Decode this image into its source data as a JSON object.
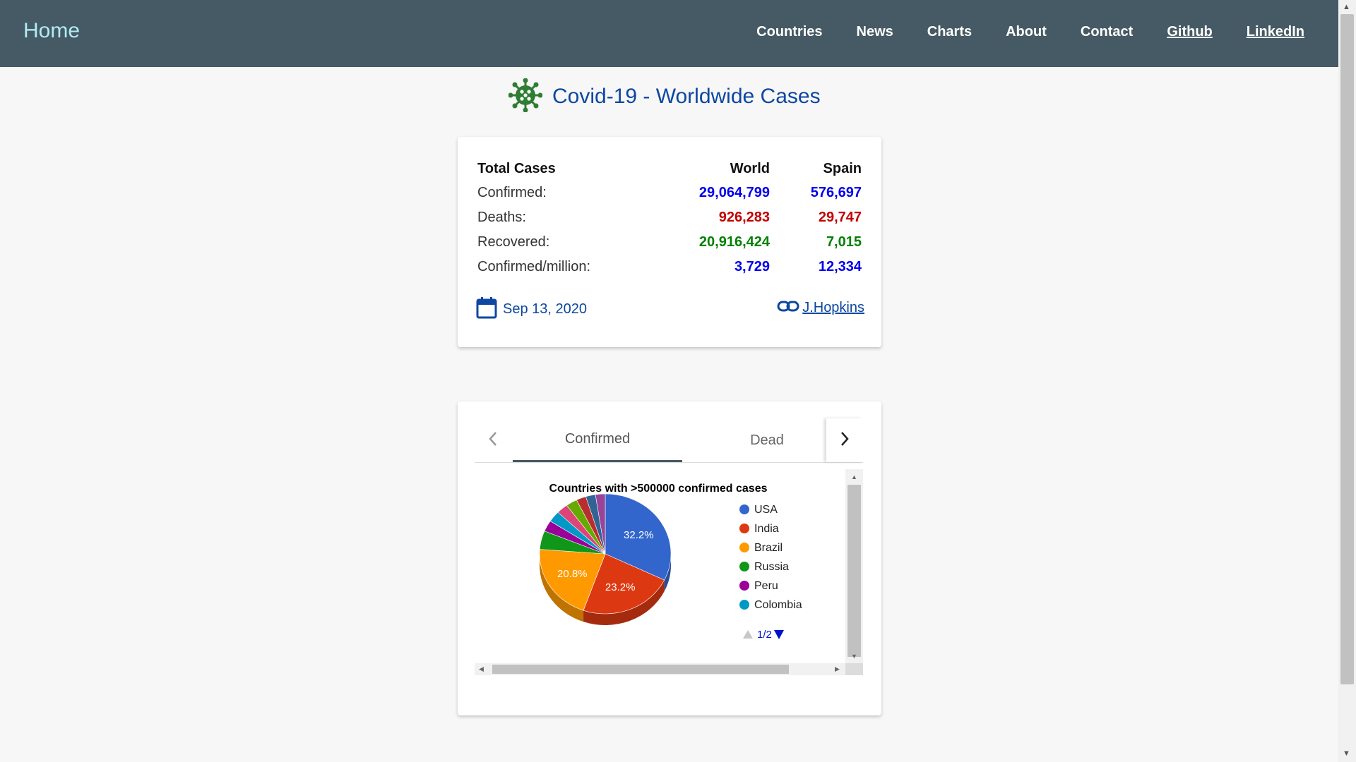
{
  "nav": {
    "brand": "Home",
    "links": [
      "Countries",
      "News",
      "Charts",
      "About",
      "Contact",
      "Github",
      "LinkedIn"
    ]
  },
  "page": {
    "title": "Covid-19 - Worldwide Cases"
  },
  "stats": {
    "header": {
      "label": "Total Cases",
      "world": "World",
      "spain": "Spain"
    },
    "rows": [
      {
        "label": "Confirmed:",
        "world": "29,064,799",
        "spain": "576,697"
      },
      {
        "label": "Deaths:",
        "world": "926,283",
        "spain": "29,747"
      },
      {
        "label": "Recovered:",
        "world": "20,916,424",
        "spain": "7,015"
      },
      {
        "label": "Confirmed/million:",
        "world": "3,729",
        "spain": "12,334"
      }
    ],
    "date": "Sep 13, 2020",
    "source": " J.Hopkins"
  },
  "tabs": {
    "items": [
      "Confirmed",
      "Dead"
    ],
    "active": 0
  },
  "colors": {
    "navbar": "#455a64",
    "brand": "#b2ebf2",
    "title": "#0d47a1",
    "icon_green": "#2e7d32",
    "confirmed": "#0000ee",
    "deaths": "#c30000",
    "recovered": "#008000"
  },
  "icons": {
    "title": "virus-icon",
    "date": "calendar-icon",
    "source": "link-icon",
    "tab_prev": "chevron-left-icon",
    "tab_next": "chevron-right-icon"
  },
  "chart_data": {
    "type": "pie",
    "title": "Countries with >500000 confirmed cases",
    "legend_position": "right",
    "legend_page": "1/2",
    "slices": [
      {
        "label": "USA",
        "percent": 32.2,
        "color": "#3366cc",
        "show_label": true
      },
      {
        "label": "India",
        "percent": 23.2,
        "color": "#dc3912",
        "show_label": true
      },
      {
        "label": "Brazil",
        "percent": 20.8,
        "color": "#ff9900",
        "show_label": true
      },
      {
        "label": "Russia",
        "percent": 5.0,
        "color": "#109618",
        "show_label": false
      },
      {
        "label": "Peru",
        "percent": 3.0,
        "color": "#990099",
        "show_label": false
      },
      {
        "label": "Colombia",
        "percent": 3.0,
        "color": "#0099c6",
        "show_label": false
      },
      {
        "label": "",
        "percent": 2.8,
        "color": "#dd4477",
        "show_label": false
      },
      {
        "label": "",
        "percent": 2.8,
        "color": "#66aa00",
        "show_label": false
      },
      {
        "label": "",
        "percent": 2.4,
        "color": "#b82e2e",
        "show_label": false
      },
      {
        "label": "",
        "percent": 2.4,
        "color": "#316395",
        "show_label": false
      },
      {
        "label": "",
        "percent": 2.4,
        "color": "#994499",
        "show_label": false
      }
    ],
    "legend_items": [
      "USA",
      "India",
      "Brazil",
      "Russia",
      "Peru",
      "Colombia"
    ]
  }
}
